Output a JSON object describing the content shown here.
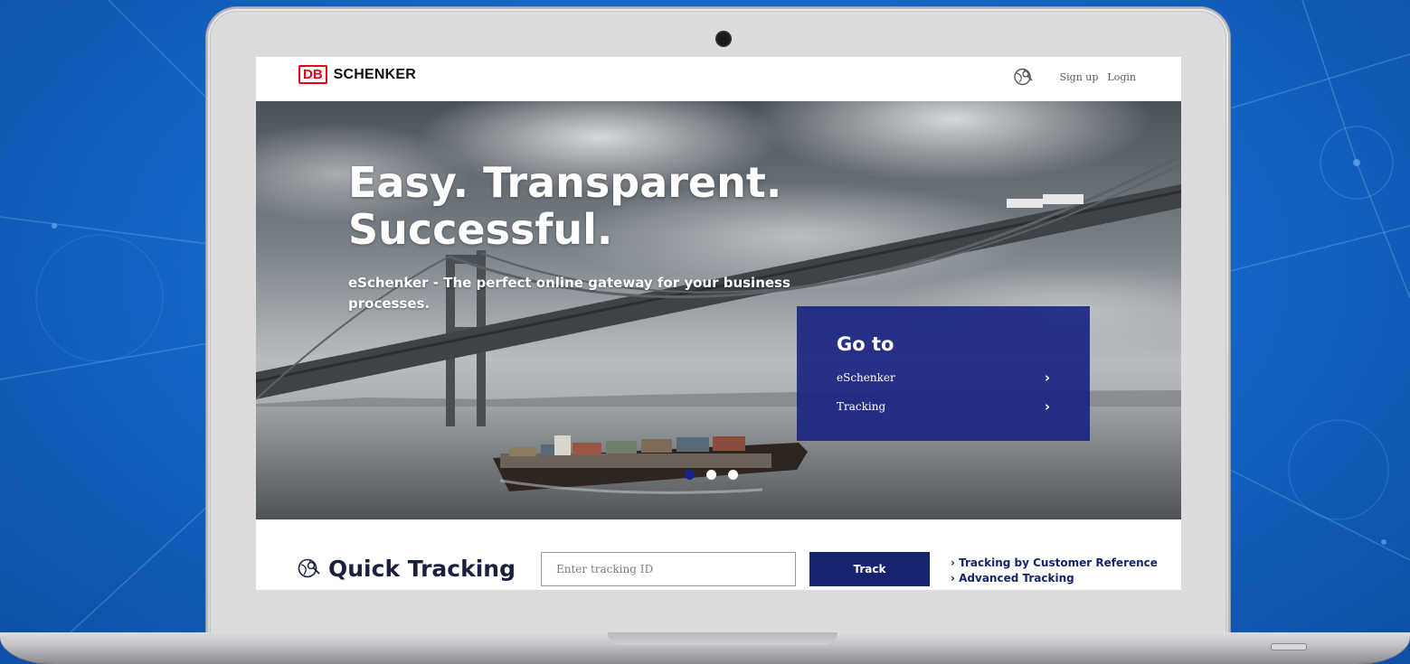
{
  "colors": {
    "brand_red": "#ec0016",
    "brand_navy": "#16236e",
    "goto_panel": "#1c2682",
    "background_blue": "#1668c9"
  },
  "header": {
    "logo_mark": "DB",
    "logo_text": "SCHENKER",
    "globe_icon": "globe-icon",
    "signup_label": "Sign up",
    "login_label": "Login"
  },
  "hero": {
    "title_line1": "Easy. Transparent.",
    "title_line2": "Successful.",
    "subtitle": "eSchenker - The perfect online gateway for your business processes.",
    "goto": {
      "title": "Go to",
      "items": [
        {
          "label": "eSchenker",
          "icon": "chevron-right-icon"
        },
        {
          "label": "Tracking",
          "icon": "chevron-right-icon"
        }
      ]
    },
    "carousel": {
      "slides": 3,
      "active": 1
    }
  },
  "tracking": {
    "icon": "globe-search-icon",
    "title": "Quick Tracking",
    "input_placeholder": "Enter tracking ID",
    "input_value": "",
    "button_label": "Track",
    "links": [
      "› Tracking by Customer Reference",
      "› Advanced Tracking"
    ]
  }
}
